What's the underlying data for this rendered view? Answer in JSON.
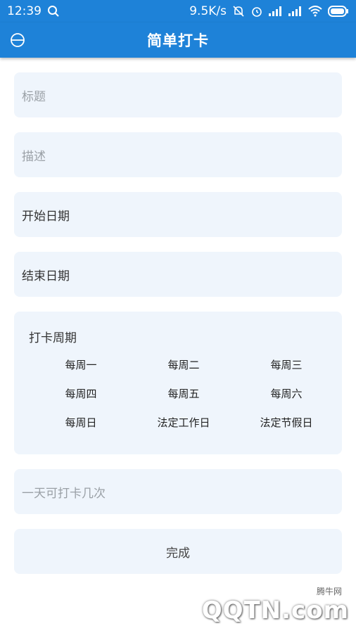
{
  "statusbar": {
    "time": "12:39",
    "speed": "9.5K/s"
  },
  "header": {
    "title": "简单打卡"
  },
  "form": {
    "title_placeholder": "标题",
    "desc_placeholder": "描述",
    "start_date_label": "开始日期",
    "end_date_label": "结束日期",
    "cycle_label": "打卡周期",
    "days": [
      "每周一",
      "每周二",
      "每周三",
      "每周四",
      "每周五",
      "每周六",
      "每周日",
      "法定工作日",
      "法定节假日"
    ],
    "times_placeholder": "一天可打卡几次",
    "done_label": "完成"
  },
  "watermark": {
    "small": "腾牛网",
    "big": "QQTN.com"
  },
  "colors": {
    "primary": "#1e82d8",
    "field_bg": "#eff5fc"
  }
}
